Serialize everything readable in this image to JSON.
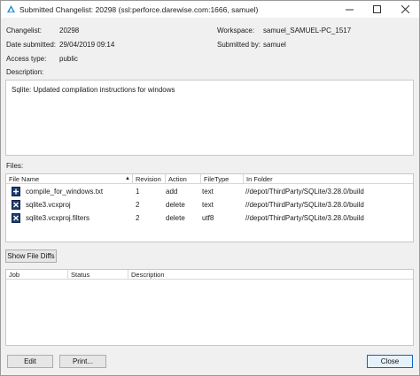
{
  "window": {
    "title": "Submitted Changelist: 20298 (ssl:perforce.darewise.com:1666,  samuel)",
    "controls": [
      "minimize-icon",
      "maximize-icon",
      "close-icon"
    ]
  },
  "fields": {
    "changelist_label": "Changelist:",
    "changelist_value": "20298",
    "date_label": "Date submitted:",
    "date_value": "29/04/2019 09:14",
    "access_label": "Access type:",
    "access_value": "public",
    "workspace_label": "Workspace:",
    "workspace_value": "samuel_SAMUEL-PC_1517",
    "submittedby_label": "Submitted by:",
    "submittedby_value": "samuel",
    "description_label": "Description:",
    "description_value": "Sqlite: Updated compilation instructions for windows"
  },
  "files": {
    "label": "Files:",
    "columns": [
      "File Name",
      "Revision",
      "Action",
      "FileType",
      "In Folder"
    ],
    "sort_indicator": "▲",
    "rows": [
      {
        "name": "compile_for_windows.txt",
        "revision": "1",
        "action": "add",
        "filetype": "text",
        "folder": "//depot/ThirdParty/SQLite/3.28.0/build",
        "icon": "file-add-icon"
      },
      {
        "name": "sqlite3.vcxproj",
        "revision": "2",
        "action": "delete",
        "filetype": "text",
        "folder": "//depot/ThirdParty/SQLite/3.28.0/build",
        "icon": "file-delete-icon"
      },
      {
        "name": "sqlite3.vcxproj.filters",
        "revision": "2",
        "action": "delete",
        "filetype": "utf8",
        "folder": "//depot/ThirdParty/SQLite/3.28.0/build",
        "icon": "file-delete-icon"
      }
    ]
  },
  "show_diffs_label": "Show File Diffs",
  "jobs": {
    "columns": [
      "Job",
      "Status",
      "Description"
    ]
  },
  "buttons": {
    "edit": "Edit",
    "print": "Print...",
    "close": "Close"
  },
  "colors": {
    "accent": "#0a64c8",
    "file_icon": "#1f3c6e"
  }
}
